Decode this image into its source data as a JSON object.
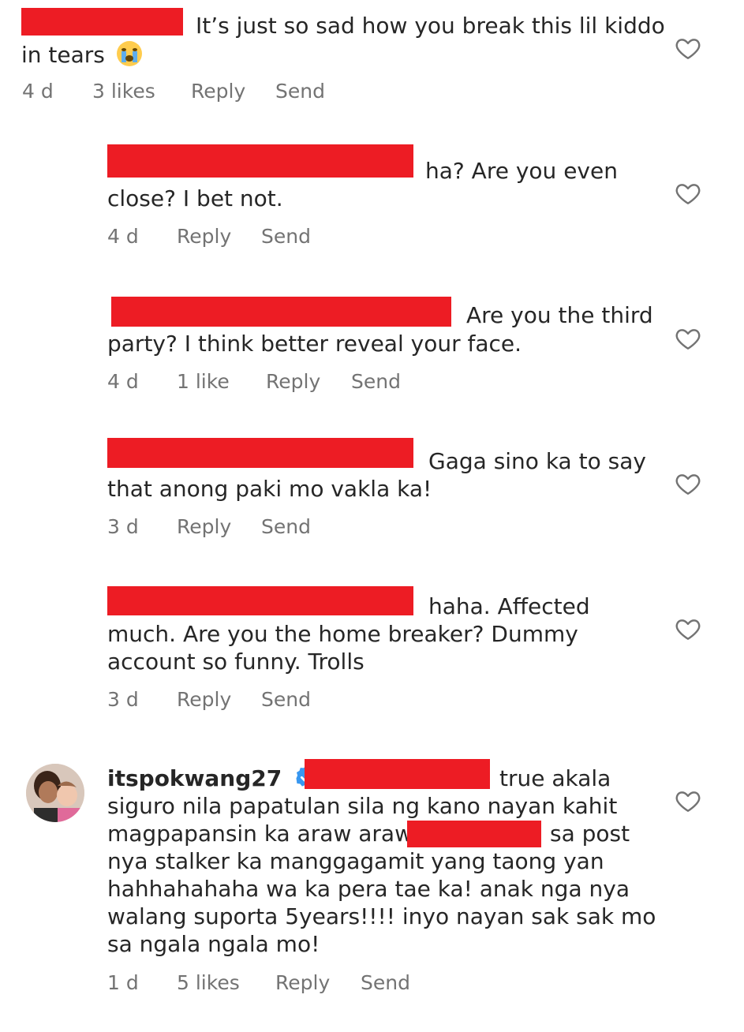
{
  "comments": [
    {
      "line1": "It’s just so sad how you break this lil kiddo",
      "line2": "in tears",
      "time": "4 d",
      "likes": "3 likes",
      "reply": "Reply",
      "send": "Send"
    },
    {
      "line1": "ha? Are you even",
      "line2": "close? I bet not.",
      "time": "4 d",
      "reply": "Reply",
      "send": "Send"
    },
    {
      "line1": "Are you the third",
      "line2": "party?  I think better reveal your face.",
      "time": "4 d",
      "likes": "1 like",
      "reply": "Reply",
      "send": "Send"
    },
    {
      "line1": "Gaga sino ka to say",
      "line2": "that anong paki mo vakla ka!",
      "time": "3 d",
      "reply": "Reply",
      "send": "Send"
    },
    {
      "line1": "haha. Affected",
      "line2": "much. Are you the home breaker?  Dummy",
      "line3": "account so funny.  Trolls",
      "time": "3 d",
      "reply": "Reply",
      "send": "Send"
    },
    {
      "username": "itspokwang27",
      "line1": "true akala",
      "line2": "siguro nila papatulan sila ng kano nayan kahit",
      "line3a": "magpapansin ka araw araw",
      "line3b": "sa post",
      "line4": "nya stalker ka manggagamit yang taong yan",
      "line5": "hahhahahaha wa ka pera tae ka! anak nga nya",
      "line6": "walang suporta 5years!!!! inyo nayan sak sak mo",
      "line7": "sa ngala ngala mo!",
      "time": "1 d",
      "likes": "5 likes",
      "reply": "Reply",
      "send": "Send"
    }
  ],
  "icons": {
    "heart": "heart-outline-icon",
    "verified": "verified-badge-icon",
    "emoji": "crying-face-emoji-icon"
  },
  "colors": {
    "redaction": "#ed1c24",
    "verified": "#3897f0",
    "text": "#262626",
    "meta": "#737373"
  }
}
